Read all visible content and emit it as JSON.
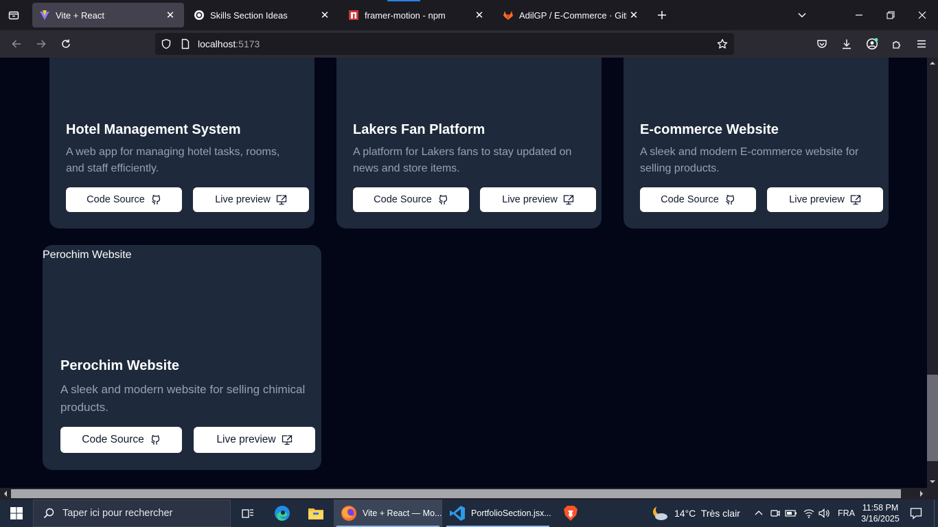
{
  "browser": {
    "tabs": [
      {
        "title": "Vite + React",
        "active": true
      },
      {
        "title": "Skills Section Ideas",
        "active": false
      },
      {
        "title": "framer-motion - npm",
        "active": false
      },
      {
        "title": "AdilGP / E-Commerce · GitLab",
        "active": false
      }
    ],
    "url_host": "localhost",
    "url_port": ":5173"
  },
  "projects": [
    {
      "title": "Hotel Management System",
      "description": "A web app for managing hotel tasks, rooms, and staff efficiently.",
      "code_label": "Code Source",
      "preview_label": "Live preview"
    },
    {
      "title": "Lakers Fan Platform",
      "description": "A platform for Lakers fans to stay updated on news and store items.",
      "code_label": "Code Source",
      "preview_label": "Live preview"
    },
    {
      "title": "E-commerce Website",
      "description": "A sleek and modern E-commerce website for selling products.",
      "code_label": "Code Source",
      "preview_label": "Live preview"
    },
    {
      "title": "Perochim Website",
      "image_alt": "Perochim Website",
      "description": "A sleek and modern website for selling chimical products.",
      "code_label": "Code Source",
      "preview_label": "Live preview"
    }
  ],
  "taskbar": {
    "search_placeholder": "Taper ici pour rechercher",
    "apps": [
      {
        "label": "Vite + React — Mo..."
      },
      {
        "label": "PortfolioSection.jsx..."
      }
    ],
    "weather": "14°C  Très clair",
    "language": "FRA",
    "time": "11:58 PM",
    "date": "3/16/2025"
  },
  "colors": {
    "page_bg": "#020617",
    "card_bg": "#1e293b",
    "muted_text": "#94a3b8"
  }
}
